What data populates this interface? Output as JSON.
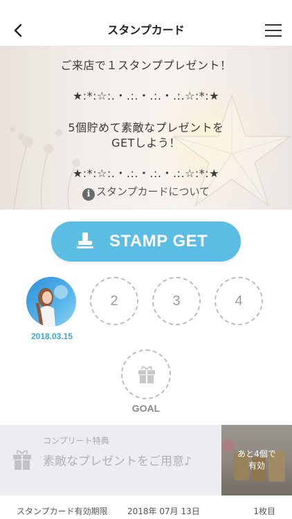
{
  "header": {
    "title": "スタンプカード",
    "back_icon": "chevron-left-icon",
    "menu_icon": "hamburger-menu-icon"
  },
  "hero": {
    "line1": "ご来店で１スタンププレゼント！",
    "decor1": "★:*:☆:.・.:.・.:.・.:.☆:*:★",
    "line2": "5個貯めて素敵なプレゼントを",
    "line3": "GETしよう！",
    "decor2": "★:*:☆:.・.:.・.:.・.:.☆:*:★",
    "about_link": "スタンプカードについて"
  },
  "stamp_button": {
    "label": "STAMP GET",
    "color": "#5bbde4"
  },
  "slots": [
    {
      "number": "",
      "filled": true,
      "date": "2018.03.15"
    },
    {
      "number": "2",
      "filled": false
    },
    {
      "number": "3",
      "filled": false
    },
    {
      "number": "4",
      "filled": false
    }
  ],
  "goal": {
    "label": "GOAL"
  },
  "complete": {
    "heading": "コンプリート特典",
    "text": "素敵なプレゼントをご用意♪",
    "remaining_line1": "あと4個で",
    "remaining_line2": "有効"
  },
  "footer": {
    "expiry_label": "スタンプカード有効期限",
    "expiry_date": "2018年 07月 13日",
    "card_count": "1枚目"
  },
  "colors": {
    "accent": "#5bbde4",
    "date_blue": "#3aa7d8"
  }
}
